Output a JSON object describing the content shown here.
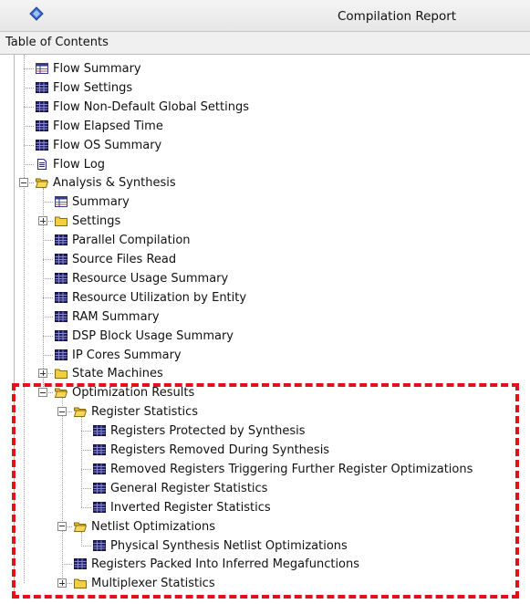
{
  "window": {
    "title": "Compilation Report",
    "icon": "app-diamond-icon"
  },
  "toc": {
    "header": "Table of Contents"
  },
  "colors": {
    "highlight": "#e3101a",
    "table_icon": "#1f1f6e",
    "folder": "#f2cf3c"
  },
  "tree": [
    {
      "label": "Flow Summary",
      "depth": 0,
      "icon": "summary-table",
      "expander": null
    },
    {
      "label": "Flow Settings",
      "depth": 0,
      "icon": "table",
      "expander": null
    },
    {
      "label": "Flow Non-Default Global Settings",
      "depth": 0,
      "icon": "table",
      "expander": null
    },
    {
      "label": "Flow Elapsed Time",
      "depth": 0,
      "icon": "table",
      "expander": null
    },
    {
      "label": "Flow OS Summary",
      "depth": 0,
      "icon": "table",
      "expander": null
    },
    {
      "label": "Flow Log",
      "depth": 0,
      "icon": "document",
      "expander": null
    },
    {
      "label": "Analysis & Synthesis",
      "depth": 0,
      "icon": "folder-open",
      "expander": "minus"
    },
    {
      "label": "Summary",
      "depth": 1,
      "icon": "summary-table",
      "expander": null
    },
    {
      "label": "Settings",
      "depth": 1,
      "icon": "folder",
      "expander": "plus"
    },
    {
      "label": "Parallel Compilation",
      "depth": 1,
      "icon": "table",
      "expander": null
    },
    {
      "label": "Source Files Read",
      "depth": 1,
      "icon": "table",
      "expander": null
    },
    {
      "label": "Resource Usage Summary",
      "depth": 1,
      "icon": "table",
      "expander": null
    },
    {
      "label": "Resource Utilization by Entity",
      "depth": 1,
      "icon": "table",
      "expander": null
    },
    {
      "label": "RAM Summary",
      "depth": 1,
      "icon": "table",
      "expander": null
    },
    {
      "label": "DSP Block Usage Summary",
      "depth": 1,
      "icon": "table",
      "expander": null
    },
    {
      "label": "IP Cores Summary",
      "depth": 1,
      "icon": "table",
      "expander": null
    },
    {
      "label": "State Machines",
      "depth": 1,
      "icon": "folder",
      "expander": "plus"
    },
    {
      "label": "Optimization Results",
      "depth": 1,
      "icon": "folder-open",
      "expander": "minus"
    },
    {
      "label": "Register Statistics",
      "depth": 2,
      "icon": "folder-open",
      "expander": "minus"
    },
    {
      "label": "Registers Protected by Synthesis",
      "depth": 3,
      "icon": "table",
      "expander": null
    },
    {
      "label": "Registers Removed During Synthesis",
      "depth": 3,
      "icon": "table",
      "expander": null
    },
    {
      "label": "Removed Registers Triggering Further Register Optimizations",
      "depth": 3,
      "icon": "table",
      "expander": null
    },
    {
      "label": "General Register Statistics",
      "depth": 3,
      "icon": "table",
      "expander": null
    },
    {
      "label": "Inverted Register Statistics",
      "depth": 3,
      "icon": "table",
      "expander": null
    },
    {
      "label": "Netlist Optimizations",
      "depth": 2,
      "icon": "folder-open",
      "expander": "minus"
    },
    {
      "label": "Physical Synthesis Netlist Optimizations",
      "depth": 3,
      "icon": "table",
      "expander": null
    },
    {
      "label": "Registers Packed Into Inferred Megafunctions",
      "depth": 2,
      "icon": "table",
      "expander": null
    },
    {
      "label": "Multiplexer Statistics",
      "depth": 2,
      "icon": "folder",
      "expander": "plus"
    }
  ]
}
